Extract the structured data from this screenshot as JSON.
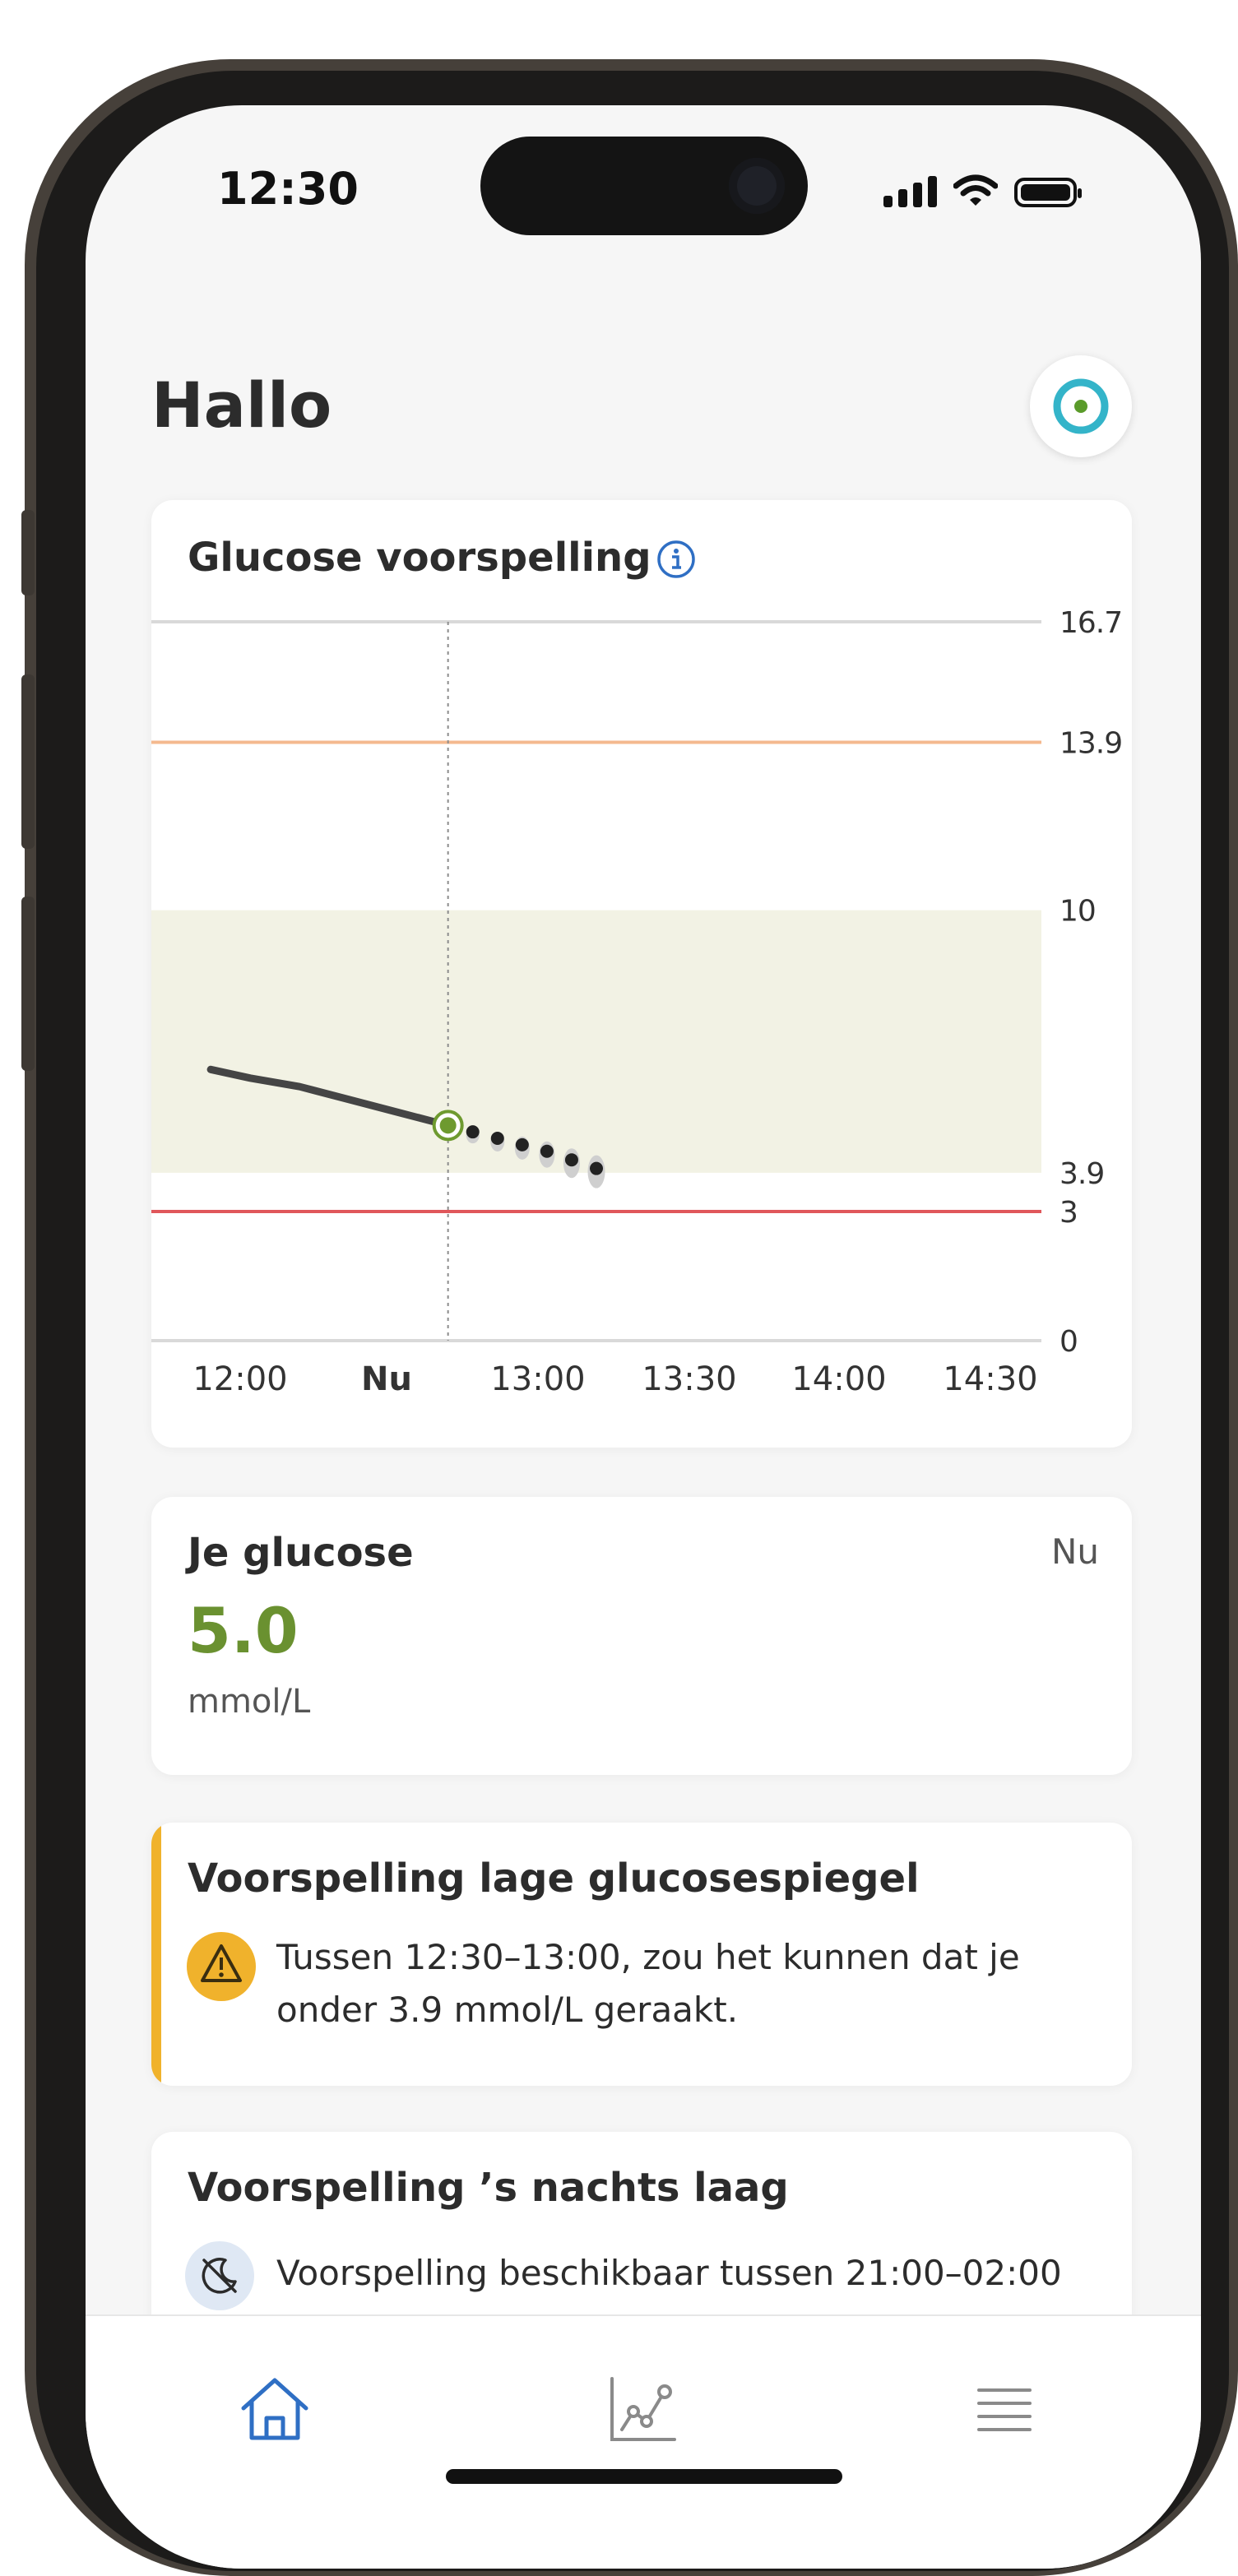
{
  "status_bar": {
    "time": "12:30"
  },
  "header": {
    "greeting": "Hallo"
  },
  "chart_card": {
    "title": "Glucose voorspelling"
  },
  "chart_data": {
    "type": "line",
    "title": "Glucose voorspelling",
    "x_tick_labels": [
      "12:00",
      "Nu",
      "13:00",
      "13:30",
      "14:00",
      "14:30"
    ],
    "y_tick_labels": [
      "0",
      "3",
      "3.9",
      "10",
      "13.9",
      "16.7"
    ],
    "ylim": [
      0,
      16.7
    ],
    "grid": true,
    "reference_lines": [
      {
        "value": 16.7,
        "color": "#d9d9d9"
      },
      {
        "value": 13.9,
        "color": "#f4b98f"
      },
      {
        "value": 3.0,
        "color": "#e0575b"
      },
      {
        "value": 0,
        "color": "#d9d9d9"
      }
    ],
    "target_band": {
      "low": 3.9,
      "high": 10,
      "color": "#f2f2e4"
    },
    "now_marker": {
      "x": "Nu",
      "value": 5.0,
      "color": "#6e9a2f"
    },
    "series": [
      {
        "values": [
          {
            "x": "11:42",
            "y": 6.3
          },
          {
            "x": "11:50",
            "y": 6.1
          },
          {
            "x": "12:00",
            "y": 5.9
          },
          {
            "x": "12:10",
            "y": 5.6
          },
          {
            "x": "12:20",
            "y": 5.3
          },
          {
            "x": "12:30",
            "y": 5.0
          }
        ],
        "color": "#454545",
        "style": "solid"
      },
      {
        "values": [
          {
            "x": "12:35",
            "y": 4.85
          },
          {
            "x": "12:40",
            "y": 4.7
          },
          {
            "x": "12:45",
            "y": 4.55
          },
          {
            "x": "12:50",
            "y": 4.4
          },
          {
            "x": "12:55",
            "y": 4.2
          },
          {
            "x": "13:00",
            "y": 4.0
          }
        ],
        "color": "#222222",
        "style": "dotted"
      }
    ]
  },
  "glucose_card": {
    "title": "Je glucose",
    "time_label": "Nu",
    "value": "5.0",
    "unit": "mmol/L",
    "value_color": "#6a9130"
  },
  "alert_card": {
    "title": "Voorspelling lage glucosespiegel",
    "line1": "Tussen 12:30–13:00, zou het kunnen dat je",
    "line2": "onder 3.9 mmol/L geraakt.",
    "accent_color": "#f0b22c"
  },
  "night_card": {
    "title": "Voorspelling ’s nachts laag",
    "text": "Voorspelling beschikbaar tussen 21:00–02:00"
  },
  "tab_bar": {
    "tabs": [
      {
        "icon": "home-icon",
        "active": true
      },
      {
        "icon": "chart-icon",
        "active": false
      },
      {
        "icon": "menu-icon",
        "active": false
      }
    ]
  }
}
